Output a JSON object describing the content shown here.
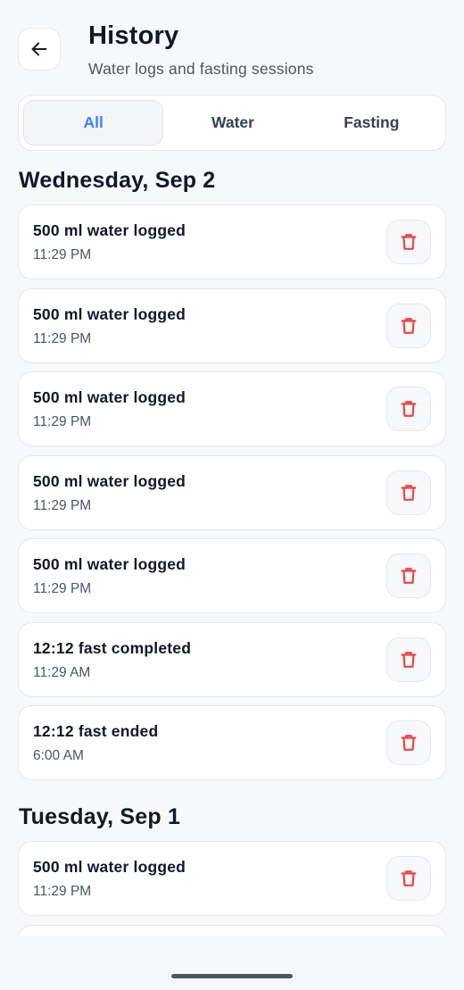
{
  "header": {
    "title": "History",
    "subtitle": "Water logs and fasting sessions",
    "back_icon": "arrow-left-icon"
  },
  "tabs": [
    {
      "label": "All",
      "active": true
    },
    {
      "label": "Water",
      "active": false
    },
    {
      "label": "Fasting",
      "active": false
    }
  ],
  "colors": {
    "accent": "#3b82f6",
    "delete": "#ef4444",
    "background": "#f7f8fa"
  },
  "days": [
    {
      "label": "Wednesday, Sep 2",
      "entries": [
        {
          "title": "500 ml water logged",
          "time": "11:29 PM"
        },
        {
          "title": "500 ml water logged",
          "time": "11:29 PM"
        },
        {
          "title": "500 ml water logged",
          "time": "11:29 PM"
        },
        {
          "title": "500 ml water logged",
          "time": "11:29 PM"
        },
        {
          "title": "500 ml water logged",
          "time": "11:29 PM"
        },
        {
          "title": "12:12 fast completed",
          "time": "11:29 AM"
        },
        {
          "title": "12:12 fast ended",
          "time": "6:00 AM"
        }
      ]
    },
    {
      "label": "Tuesday, Sep 1",
      "entries": [
        {
          "title": "500 ml water logged",
          "time": "11:29 PM"
        },
        {
          "title": "",
          "time": ""
        }
      ]
    }
  ],
  "delete_icon": "trash-icon"
}
